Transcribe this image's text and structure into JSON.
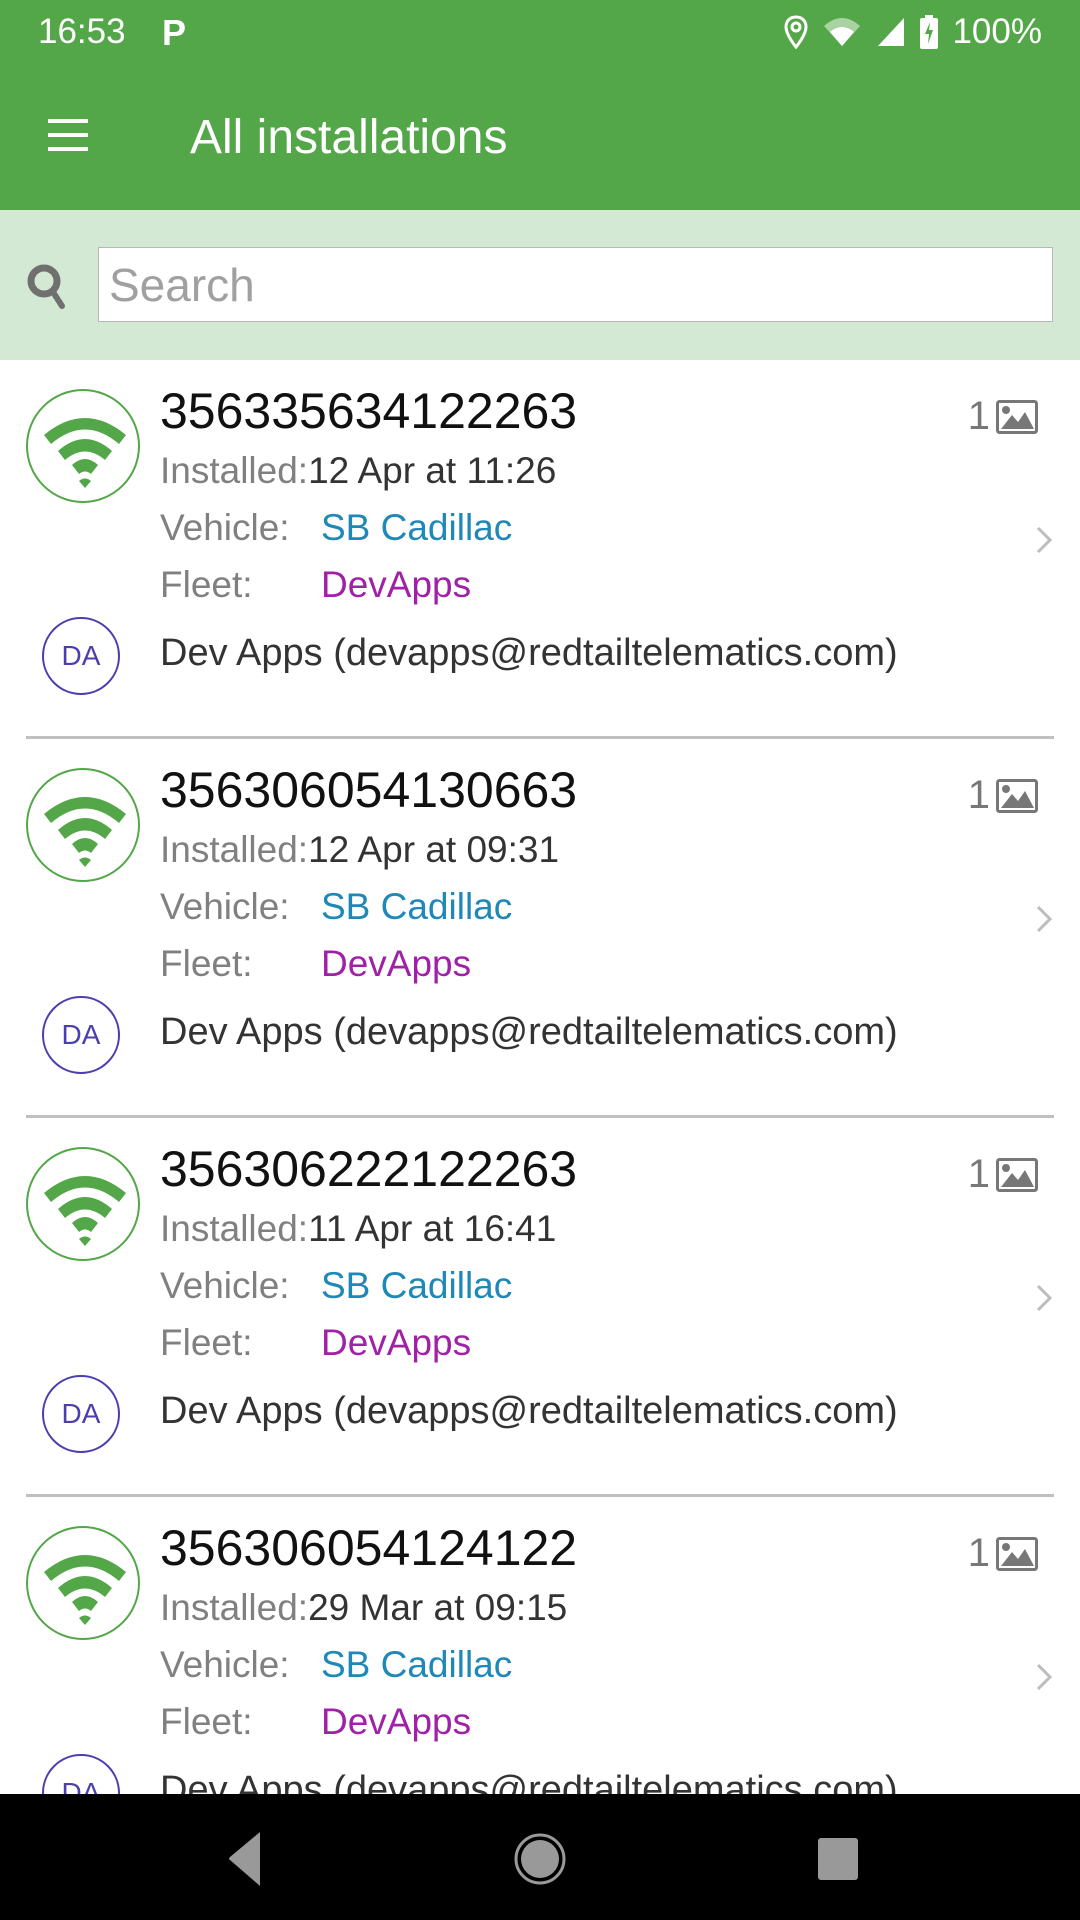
{
  "status_bar": {
    "time": "16:53",
    "notification_icon": "parking-p-icon",
    "icons": [
      "location-icon",
      "wifi-icon",
      "cell-signal-icon",
      "battery-charging-icon"
    ],
    "battery": "100%"
  },
  "app_bar": {
    "menu_icon": "hamburger-menu-icon",
    "title": "All installations",
    "color": "#53a748"
  },
  "search": {
    "icon": "search-icon",
    "placeholder": "Search",
    "value": ""
  },
  "labels": {
    "installed": "Installed:",
    "vehicle": "Vehicle:",
    "fleet": "Fleet:"
  },
  "installations": [
    {
      "imei": "356335634122263",
      "installed": "12 Apr at 11:26",
      "vehicle": "SB Cadillac",
      "fleet": "DevApps",
      "avatar_initials": "DA",
      "owner": "Dev Apps (devapps@redtailtelematics.com)",
      "photo_count": "1",
      "status_icon": "wifi-connected-icon"
    },
    {
      "imei": "356306054130663",
      "installed": "12 Apr at 09:31",
      "vehicle": "SB Cadillac",
      "fleet": "DevApps",
      "avatar_initials": "DA",
      "owner": "Dev Apps (devapps@redtailtelematics.com)",
      "photo_count": "1",
      "status_icon": "wifi-connected-icon"
    },
    {
      "imei": "356306222122263",
      "installed": "11 Apr at 16:41",
      "vehicle": "SB Cadillac",
      "fleet": "DevApps",
      "avatar_initials": "DA",
      "owner": "Dev Apps (devapps@redtailtelematics.com)",
      "photo_count": "1",
      "status_icon": "wifi-connected-icon"
    },
    {
      "imei": "356306054124122",
      "installed": "29 Mar at 09:15",
      "vehicle": "SB Cadillac",
      "fleet": "DevApps",
      "avatar_initials": "DA",
      "owner": "Dev Apps (devapps@redtailtelematics.com)",
      "photo_count": "1",
      "status_icon": "wifi-connected-icon"
    }
  ],
  "colors": {
    "primary_green": "#53a748",
    "search_bg": "#d4e9d4",
    "vehicle_link": "#1e88b8",
    "fleet_link": "#a020a8",
    "avatar": "#4b3fb0"
  },
  "nav_bar": {
    "buttons": [
      "back-icon",
      "home-icon",
      "recents-icon"
    ]
  }
}
